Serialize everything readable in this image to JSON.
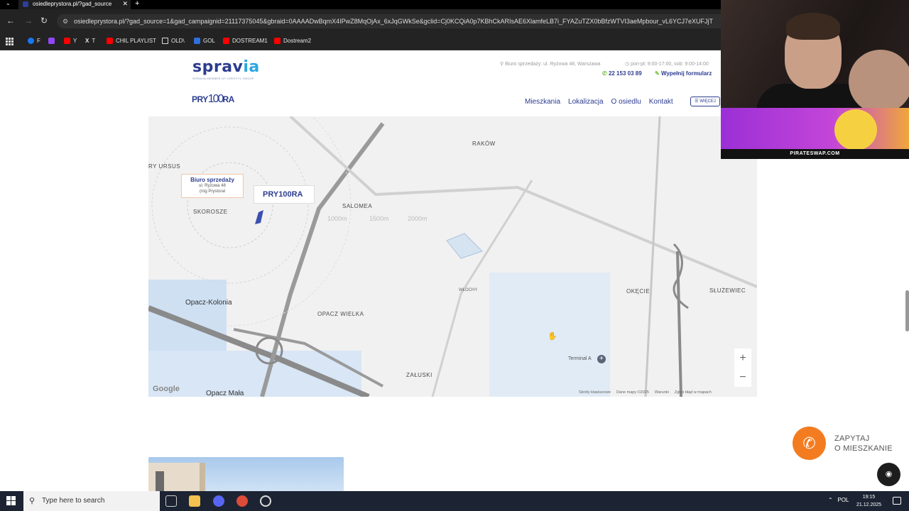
{
  "browser": {
    "tab_title": "osiedleprystora.pl/?gad_source",
    "url": "osiedleprystora.pl/?gad_source=1&gad_campaignid=21117375045&gbraid=0AAAADwBqmX4IPwZ8MqOjAx_6xJqGWkSe&gclid=Cj0KCQiA0p7KBhCkARIsAE6XlamfeLB7i_FYAZuTZX0bBfzWTVI3aeMpbour_vL6YCJ7eXUFJjT",
    "bookmarks": [
      {
        "label": "F",
        "color": "#1877f2"
      },
      {
        "label": "",
        "color": "#9146ff"
      },
      {
        "label": "Y",
        "color": "#ff0000"
      },
      {
        "label": "T",
        "color": "#ffffff"
      },
      {
        "label": "CHIL PLAYLIST",
        "color": "#ff0000"
      },
      {
        "label": "OLD\\",
        "color": "#dddddd"
      },
      {
        "label": "GOL",
        "color": "#2f6fdb"
      },
      {
        "label": "DOSTREAM1",
        "color": "#ff0000"
      },
      {
        "label": "Dostream2",
        "color": "#ff0000"
      }
    ]
  },
  "site": {
    "logo_text_a": "sprav",
    "logo_text_b": "ia",
    "logo_sub": "SPRAVIA MEMBER OF CRESTYL GROUP",
    "office_address": "Biuro sprzedaży: ul. Ryżowa 48, Warszawa",
    "hours": "pon-pt: 9:00-17:00, sob: 9:00-14:00",
    "phone": "22 153 03 89",
    "form_link": "Wypełnij formularz",
    "project_logo_a": "PRY",
    "project_logo_num": "100",
    "project_logo_b": "RA",
    "nav": [
      "Mieszkania",
      "Lokalizacja",
      "O osiedlu",
      "Kontakt"
    ],
    "more_label": "WIĘCEJ"
  },
  "map": {
    "districts": {
      "rakow": "RAKÓW",
      "ursus": "RY URSUS",
      "skorosze": "SKOROSZE",
      "salomea": "SALOMEA",
      "opacz_kolonia": "Opacz-Kolonia",
      "opacz_wielka": "OPACZ WIELKA",
      "wlochy": "WŁOCHY",
      "okecie": "OKĘCIE",
      "sluzewiec": "SŁUŻEWIEC",
      "zaluski": "ZAŁUSKI",
      "opacz_mala": "Opacz Mała"
    },
    "distances": [
      "1000m",
      "1500m",
      "2000m"
    ],
    "office_callout_title": "Biuro sprzedaży",
    "office_callout_line1": "ul. Ryżowa 48",
    "office_callout_line2": "(róg Prystoral",
    "terminal": "Terminal A",
    "google": "Google",
    "attribution": [
      "Skróty klawiszowe",
      "Dane mapy ©2025",
      "Warunki",
      "Zgłoś błąd w mapach"
    ],
    "zoom_in": "+",
    "zoom_out": "−"
  },
  "cta": {
    "line1": "ZAPYTAJ",
    "line2": "O MIESZKANIE"
  },
  "promo": {
    "banner": "PIRATESWAP.COM"
  },
  "taskbar": {
    "search_placeholder": "Type here to search",
    "lang": "POL",
    "time": "19:15",
    "date": "21.12.2025"
  }
}
